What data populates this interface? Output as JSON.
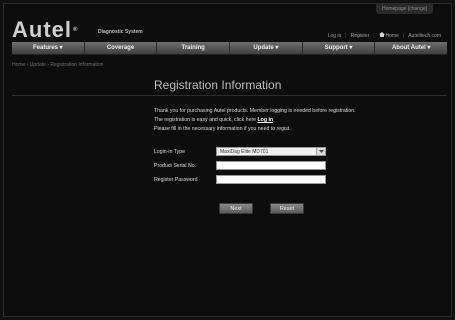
{
  "header": {
    "top_tab": "Homepage [change]",
    "logo_text": "Autel",
    "logo_reg": "®",
    "logo_subtitle": "Diagnostic System",
    "links": {
      "login": "Log in",
      "register": "Register",
      "home": "Home",
      "site": "Autelitech.com"
    }
  },
  "nav": {
    "items": [
      "Features ▾",
      "Coverage",
      "Training",
      "Update ▾",
      "Support ▾",
      "About Autel ▾"
    ]
  },
  "breadcrumb": "Home › Update › Registration Information",
  "page": {
    "title": "Registration Information",
    "intro_line1": "Thank you for purchasing Autel products. Member logging is needed before registration.",
    "intro_line2_prefix": "The registration is easy and quick, click here ",
    "intro_line2_link": "Log in",
    "intro_line3": "Please fill in the necessary information if you need to regist."
  },
  "form": {
    "login_type_label": "Login-in Type",
    "login_type_value": "MaxiDag Elite MD701",
    "serial_label": "Product Serial No.",
    "serial_value": "",
    "password_label": "Register Password",
    "password_value": ""
  },
  "buttons": {
    "next": "Next",
    "reset": "Reset"
  }
}
